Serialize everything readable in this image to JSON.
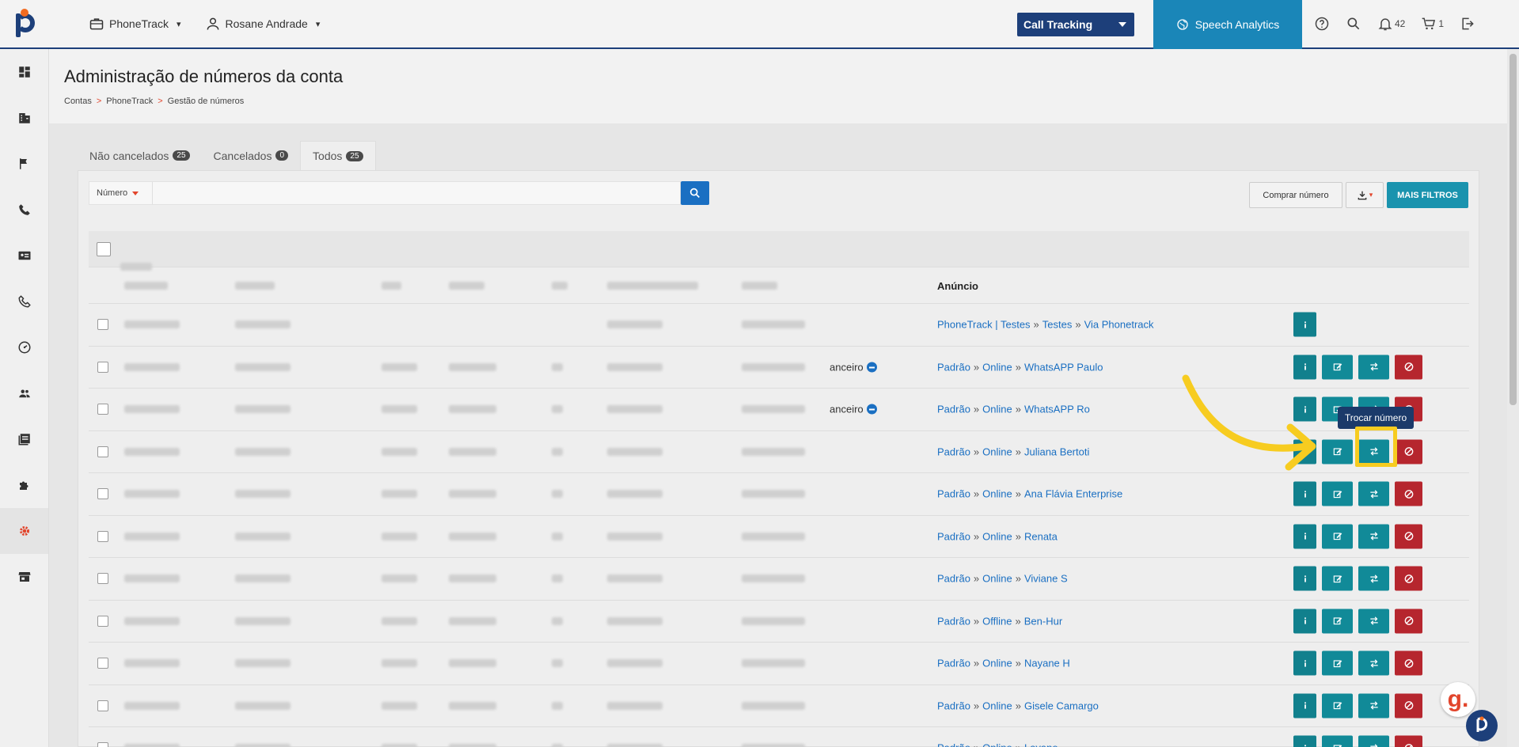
{
  "topbar": {
    "company": "PhoneTrack",
    "user": "Rosane Andrade",
    "product_select": "Call Tracking",
    "speech_label": "Speech Analytics",
    "notifications": "42",
    "cart": "1"
  },
  "page": {
    "title": "Administração de números da conta",
    "breadcrumb": [
      "Contas",
      "PhoneTrack",
      "Gestão de números"
    ],
    "breadcrumb_sep": ">"
  },
  "tabs": [
    {
      "label": "Não cancelados",
      "count": "25"
    },
    {
      "label": "Cancelados",
      "count": "0"
    },
    {
      "label": "Todos",
      "count": "25"
    }
  ],
  "filter": {
    "field_label": "Número",
    "buy_label": "Comprar número",
    "more_filters_label": "MAIS FILTROS"
  },
  "table": {
    "ad_header": "Anúncio",
    "row_fin_label": "anceiro",
    "separator": "»",
    "rows": [
      {
        "ad": [
          "PhoneTrack | Testes",
          "Testes",
          "Via Phonetrack"
        ],
        "fin": false,
        "full": false
      },
      {
        "ad": [
          "Padrão",
          "Online",
          "WhatsAPP Paulo"
        ],
        "fin": true,
        "full": true
      },
      {
        "ad": [
          "Padrão",
          "Online",
          "WhatsAPP Ro"
        ],
        "fin": true,
        "full": true
      },
      {
        "ad": [
          "Padrão",
          "Online",
          "Juliana Bertoti"
        ],
        "fin": false,
        "full": true
      },
      {
        "ad": [
          "Padrão",
          "Online",
          "Ana Flávia Enterprise"
        ],
        "fin": false,
        "full": true
      },
      {
        "ad": [
          "Padrão",
          "Online",
          "Renata"
        ],
        "fin": false,
        "full": true
      },
      {
        "ad": [
          "Padrão",
          "Online",
          "Viviane S"
        ],
        "fin": false,
        "full": true
      },
      {
        "ad": [
          "Padrão",
          "Offline",
          "Ben-Hur"
        ],
        "fin": false,
        "full": true
      },
      {
        "ad": [
          "Padrão",
          "Online",
          "Nayane H"
        ],
        "fin": false,
        "full": true
      },
      {
        "ad": [
          "Padrão",
          "Online",
          "Gisele Camargo"
        ],
        "fin": false,
        "full": true
      },
      {
        "ad": [
          "Padrão",
          "Online",
          "Layane"
        ],
        "fin": false,
        "full": true
      }
    ]
  },
  "tooltip": "Trocar número",
  "colors": {
    "brand_navy": "#1d3f7a",
    "teal": "#118a98",
    "danger": "#b6262e",
    "highlight": "#f7cc20",
    "link": "#1a6fc2"
  }
}
